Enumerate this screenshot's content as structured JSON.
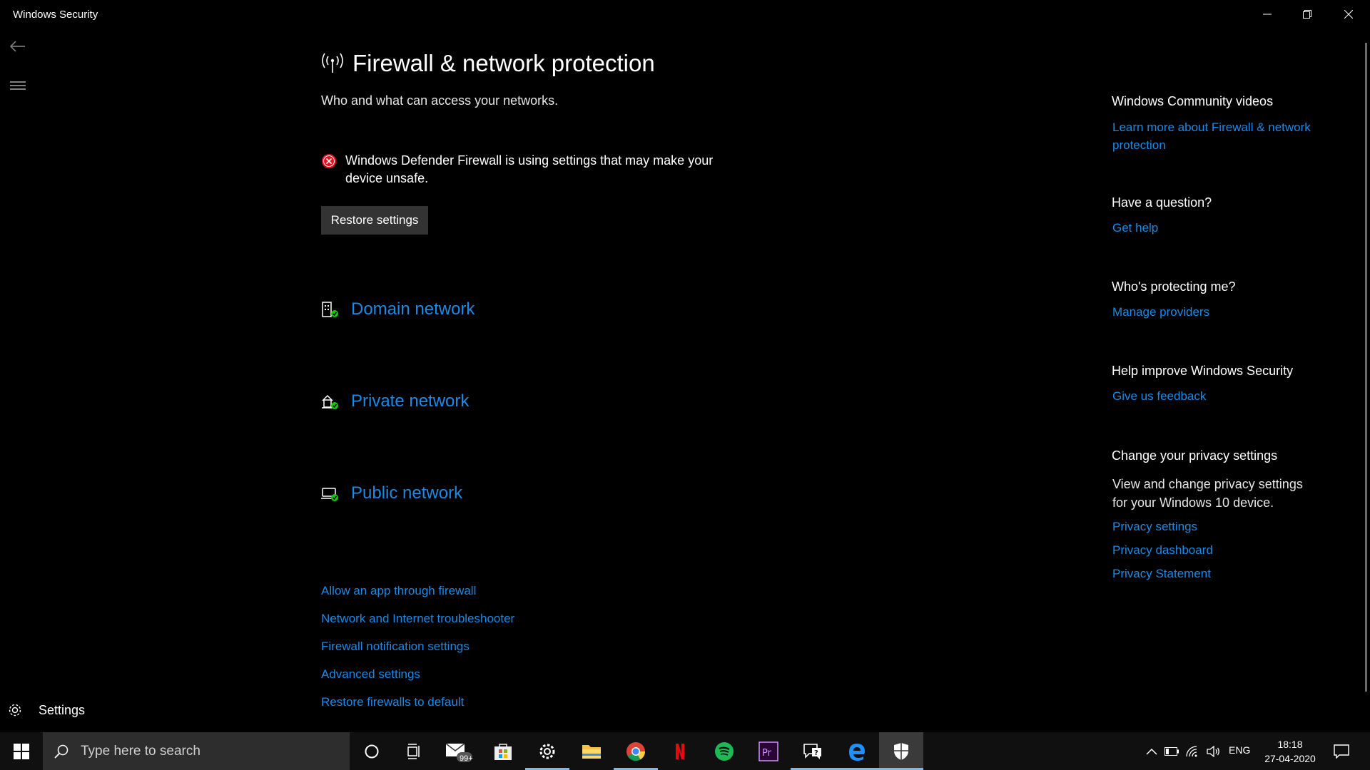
{
  "window": {
    "title": "Windows Security",
    "controls": {
      "minimize": "—",
      "restore": "❐",
      "close": "✕"
    }
  },
  "nav": {
    "back_icon": "back-arrow-icon",
    "menu_icon": "hamburger-icon",
    "settings_label": "Settings"
  },
  "main": {
    "title": "Firewall & network protection",
    "subtitle": "Who and what can access your networks.",
    "alert": {
      "text": "Windows Defender Firewall is using settings that may make your device unsafe.",
      "icon": "error-icon",
      "color": "#e81123"
    },
    "restore_button": "Restore settings",
    "networks": [
      {
        "label": "Domain network",
        "icon": "domain-network-icon"
      },
      {
        "label": "Private network",
        "icon": "private-network-icon"
      },
      {
        "label": "Public network",
        "icon": "public-network-icon"
      }
    ],
    "links": [
      "Allow an app through firewall",
      "Network and Internet troubleshooter",
      "Firewall notification settings",
      "Advanced settings",
      "Restore firewalls to default"
    ]
  },
  "side": {
    "community": {
      "heading": "Windows Community videos",
      "link": "Learn more about Firewall & network protection"
    },
    "question": {
      "heading": "Have a question?",
      "link": "Get help"
    },
    "protecting": {
      "heading": "Who's protecting me?",
      "link": "Manage providers"
    },
    "improve": {
      "heading": "Help improve Windows Security",
      "link": "Give us feedback"
    },
    "privacy": {
      "heading": "Change your privacy settings",
      "text": "View and change privacy settings for your Windows 10 device.",
      "links": [
        "Privacy settings",
        "Privacy dashboard",
        "Privacy Statement"
      ]
    }
  },
  "taskbar": {
    "search_placeholder": "Type here to search",
    "mail_badge": "99+",
    "language": "ENG",
    "time": "18:18",
    "date": "27-04-2020"
  },
  "colors": {
    "accent_link": "#1b8ae6",
    "background": "#000000",
    "ok_green": "#16c60c"
  }
}
